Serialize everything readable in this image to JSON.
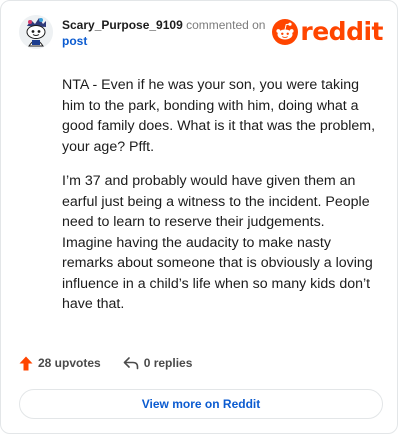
{
  "comment": {
    "username": "Scary_Purpose_9109",
    "action_text": "commented on",
    "target_label": "post",
    "brand_name": "reddit",
    "paragraphs": [
      "NTA - Even if he was your son, you were taking him to the park, bonding with him, doing what a good family does. What is it that was the problem, your age? Pfft.",
      "I’m 37 and probably would have given them an earful just being a witness to the incident. People need to learn to reserve their judgements. Imagine having the audacity to make nasty remarks about someone that is obviously a loving influence in a child’s life when so many kids don’t have that."
    ],
    "upvotes_label": "28 upvotes",
    "replies_label": "0 replies",
    "view_more_label": "View more on Reddit"
  },
  "colors": {
    "brand": "#ff4500",
    "link": "#0b5bd0",
    "text": "#1c1c1c",
    "muted": "#7c7c7c",
    "border": "#e3e6e8"
  },
  "icons": {
    "avatar": "snoo-avatar-icon",
    "brand": "reddit-logo-icon",
    "upvote": "upvote-arrow-icon",
    "reply": "reply-arrow-icon"
  }
}
